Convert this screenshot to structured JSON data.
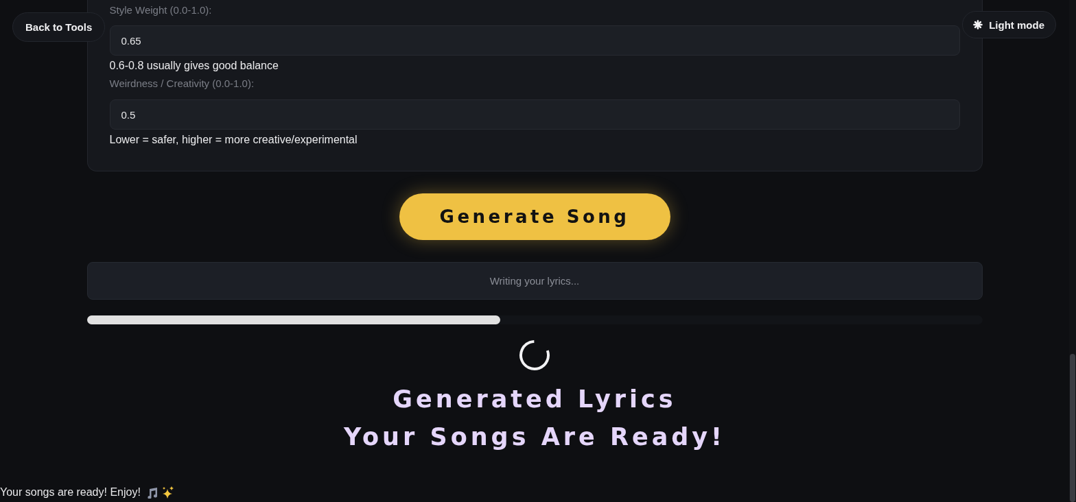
{
  "nav": {
    "back_button": "Back to Tools",
    "theme_toggle": "Light mode"
  },
  "settings_card": {
    "fields": [
      {
        "label": "Style Weight (0.0-1.0):",
        "value": "0.65",
        "hint": "0.6-0.8 usually gives good balance"
      },
      {
        "label": "Weirdness / Creativity (0.0-1.0):",
        "value": "0.5",
        "hint": "Lower = safer, higher = more creative/experimental"
      }
    ]
  },
  "generate_button": "Generate Song",
  "status": {
    "message": "Writing your lyrics..."
  },
  "progress": {
    "level": 0.462
  },
  "headings": [
    "Generated Lyrics",
    "Your Songs Are Ready!"
  ],
  "toast": {
    "message": "Your songs are ready! Enjoy!"
  }
}
